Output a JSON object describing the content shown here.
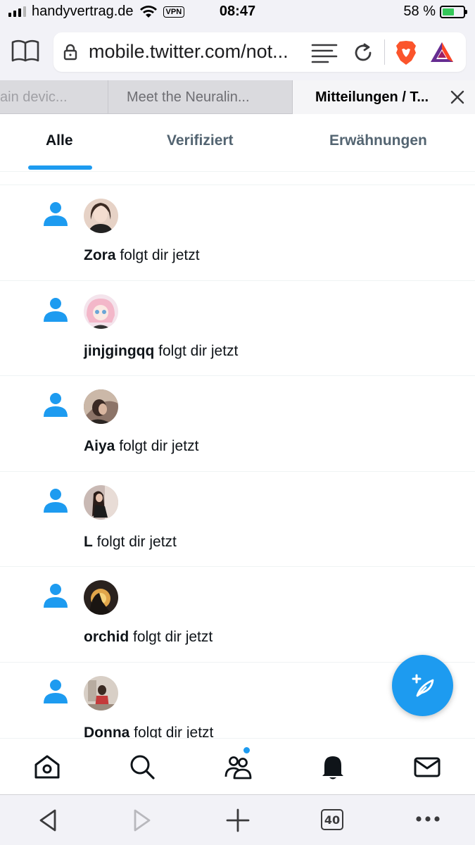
{
  "status_bar": {
    "carrier": "handyvertrag.de",
    "vpn": "VPN",
    "time": "08:47",
    "battery": "58 %",
    "battery_level": 0.58
  },
  "browser": {
    "url": "mobile.twitter.com/not...",
    "tabs": [
      {
        "title": "ain devic..."
      },
      {
        "title": "Meet the Neuralin..."
      },
      {
        "title": "Mitteilungen / T..."
      }
    ],
    "tab_count": "40"
  },
  "twitter": {
    "tabs": [
      {
        "label": "Alle",
        "active": true
      },
      {
        "label": "Verifiziert",
        "active": false
      },
      {
        "label": "Erwähnungen",
        "active": false
      }
    ],
    "notifications": [
      {
        "name": "Zora",
        "text": " folgt dir jetzt"
      },
      {
        "name": "jinjgingqq",
        "text": " folgt dir jetzt"
      },
      {
        "name": "Aiya",
        "text": " folgt dir jetzt"
      },
      {
        "name": "L",
        "text": " folgt dir jetzt"
      },
      {
        "name": "orchid",
        "text": " folgt dir jetzt"
      },
      {
        "name": "Donna",
        "text": " folgt dir jetzt"
      }
    ],
    "bottom_nav": [
      "home-icon",
      "search-icon",
      "communities-icon",
      "notifications-icon",
      "messages-icon"
    ]
  },
  "colors": {
    "accent": "#1d9bf0",
    "text": "#0f1419",
    "muted": "#536471"
  }
}
